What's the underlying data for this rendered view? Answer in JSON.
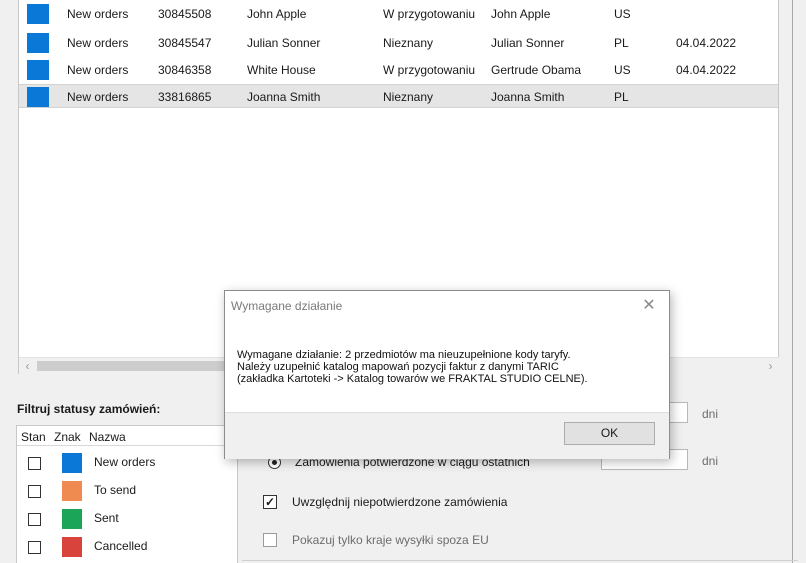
{
  "orders": [
    {
      "status": "New orders",
      "number": "30845508",
      "name": "John Apple",
      "state": "W przygotowaniu",
      "customer": "John Apple",
      "country": "US",
      "date": "",
      "color": "#0a78d7"
    },
    {
      "status": "New orders",
      "number": "30845547",
      "name": "Julian Sonner",
      "state": "Nieznany",
      "customer": "Julian Sonner",
      "country": "PL",
      "date": "04.04.2022",
      "color": "#0a78d7"
    },
    {
      "status": "New orders",
      "number": "30846358",
      "name": "White House",
      "state": "W przygotowaniu",
      "customer": "Gertrude Obama",
      "country": "US",
      "date": "04.04.2022",
      "color": "#0a78d7"
    },
    {
      "status": "New orders",
      "number": "33816865",
      "name": "Joanna Smith",
      "state": "Nieznany",
      "customer": "Joanna Smith",
      "country": "PL",
      "date": "",
      "color": "#0a78d7"
    }
  ],
  "filter": {
    "title": "Filtruj statusy zamówień:",
    "headers": {
      "stan": "Stan",
      "znak": "Znak",
      "nazwa": "Nazwa"
    },
    "statuses": [
      {
        "label": "New orders",
        "color": "#0a78d7"
      },
      {
        "label": "To send",
        "color": "#ef8a50"
      },
      {
        "label": "Sent",
        "color": "#1aa558"
      },
      {
        "label": "Cancelled",
        "color": "#d8433b"
      }
    ]
  },
  "options": {
    "days_unit_1": "dni",
    "confirmed_label": "Zamówienia potwierdzone w ciągu ostatnich",
    "days_unit_2": "dni",
    "include_unconfirmed_label": "Uwzględnij niepotwierdzone zamówienia",
    "only_non_eu_label": "Pokazuj tylko kraje wysyłki spoza EU"
  },
  "dialog": {
    "title": "Wymagane działanie",
    "message_line1": "Wymagane działanie: 2 przedmiotów ma nieuzupełnione kody taryfy.",
    "message_line2": "Należy uzupełnić katalog mapowań pozycji faktur z danymi TARIC",
    "message_line3": "(zakładka Kartoteki -> Katalog towarów we FRAKTAL STUDIO CELNE).",
    "ok_label": "OK"
  },
  "icons": {
    "close": "close-icon",
    "scroll_left": "chevron-left-icon",
    "scroll_right": "chevron-right-icon",
    "check": "checkmark-icon"
  }
}
